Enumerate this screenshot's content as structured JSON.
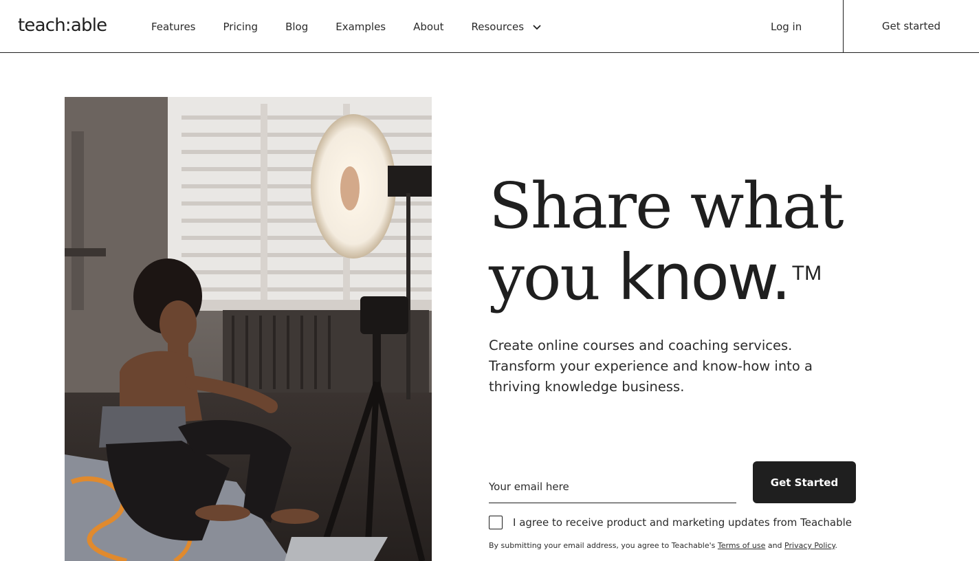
{
  "header": {
    "logo": "teach:able",
    "nav": [
      {
        "label": "Features"
      },
      {
        "label": "Pricing"
      },
      {
        "label": "Blog"
      },
      {
        "label": "Examples"
      },
      {
        "label": "About"
      },
      {
        "label": "Resources"
      }
    ],
    "login_label": "Log in",
    "get_started_label": "Get started"
  },
  "hero": {
    "headline_line1": "Share what",
    "headline_line2_a": "you ",
    "headline_line2_b": "know.",
    "headline_tm": "TM",
    "subtext": "Create online courses and coaching services. Transform your experience and know-how into a thriving knowledge business.",
    "email_placeholder": "Your email here",
    "email_value": "",
    "cta_label": "Get Started",
    "consent_label": "I agree to receive product and marketing updates from Teachable",
    "legal_prefix": "By submitting your email address, you agree to Teachable's ",
    "terms_label": "Terms of use",
    "legal_and": " and ",
    "privacy_label": "Privacy Policy",
    "legal_suffix": "."
  },
  "colors": {
    "text": "#1f1f1f",
    "cta_bg": "#1f1f1f",
    "background": "#ffffff"
  },
  "icons": {
    "resources_dropdown": "chevron-down-icon"
  }
}
